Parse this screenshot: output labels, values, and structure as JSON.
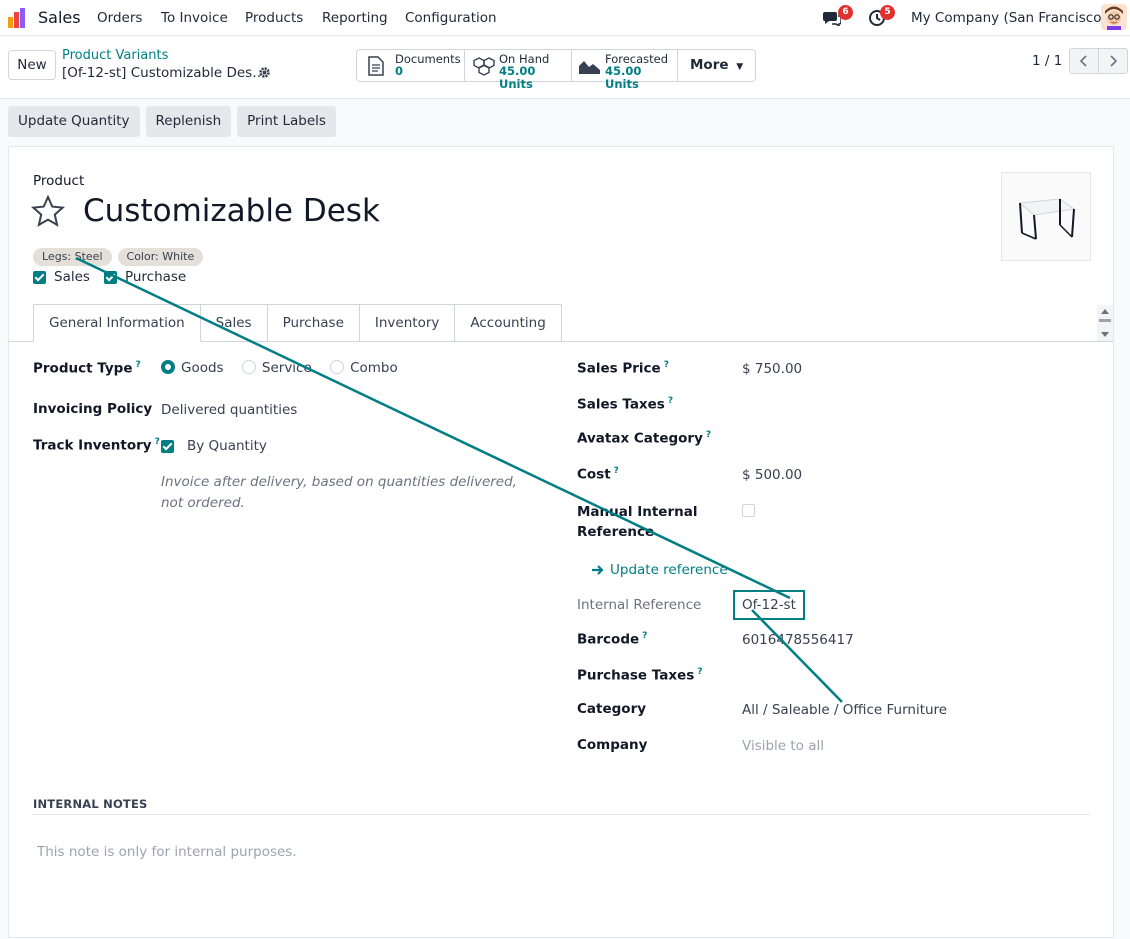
{
  "navbar": {
    "app_name": "Sales",
    "menu": [
      "Orders",
      "To Invoice",
      "Products",
      "Reporting",
      "Configuration"
    ],
    "messages_count": "6",
    "activities_count": "5",
    "company": "My Company (San Francisco)"
  },
  "control": {
    "new_label": "New",
    "breadcrumb_parent": "Product Variants",
    "breadcrumb_current": "[Of-12-st] Customizable Des…",
    "stats": [
      {
        "label": "Documents",
        "value": "0"
      },
      {
        "label": "On Hand",
        "value": "45.00 Units"
      },
      {
        "label": "Forecasted",
        "value": "45.00 Units"
      }
    ],
    "more_label": "More",
    "pager": "1 / 1"
  },
  "actions": [
    "Update Quantity",
    "Replenish",
    "Print Labels"
  ],
  "product": {
    "label": "Product",
    "name": "Customizable Desk",
    "tags": [
      "Legs: Steel",
      "Color: White"
    ],
    "can_sell_label": "Sales",
    "can_purchase_label": "Purchase"
  },
  "tabs": [
    "General Information",
    "Sales",
    "Purchase",
    "Inventory",
    "Accounting"
  ],
  "left_fields": {
    "product_type_label": "Product Type",
    "product_type_options": [
      "Goods",
      "Service",
      "Combo"
    ],
    "invoicing_policy_label": "Invoicing Policy",
    "invoicing_policy_value": "Delivered quantities",
    "track_inventory_label": "Track Inventory",
    "track_inventory_value": "By Quantity",
    "invoice_help": "Invoice after delivery, based on quantities delivered, not ordered."
  },
  "right_fields": {
    "sales_price_label": "Sales Price",
    "sales_price_value": "$ 750.00",
    "sales_taxes_label": "Sales Taxes",
    "avatax_label": "Avatax Category",
    "cost_label": "Cost",
    "cost_value": "$ 500.00",
    "manual_ref_label": "Manual Internal Reference",
    "update_reference_label": "Update reference",
    "internal_ref_label": "Internal Reference",
    "internal_ref_value": "Of-12-st",
    "barcode_label": "Barcode",
    "barcode_value": "6016478556417",
    "purchase_taxes_label": "Purchase Taxes",
    "category_label": "Category",
    "category_value": "All / Saleable / Office Furniture",
    "company_label": "Company",
    "company_value": "Visible to all"
  },
  "notes": {
    "title": "INTERNAL NOTES",
    "placeholder": "This note is only for internal purposes."
  },
  "colors": {
    "accent": "#017e84",
    "badge": "#e03131"
  }
}
